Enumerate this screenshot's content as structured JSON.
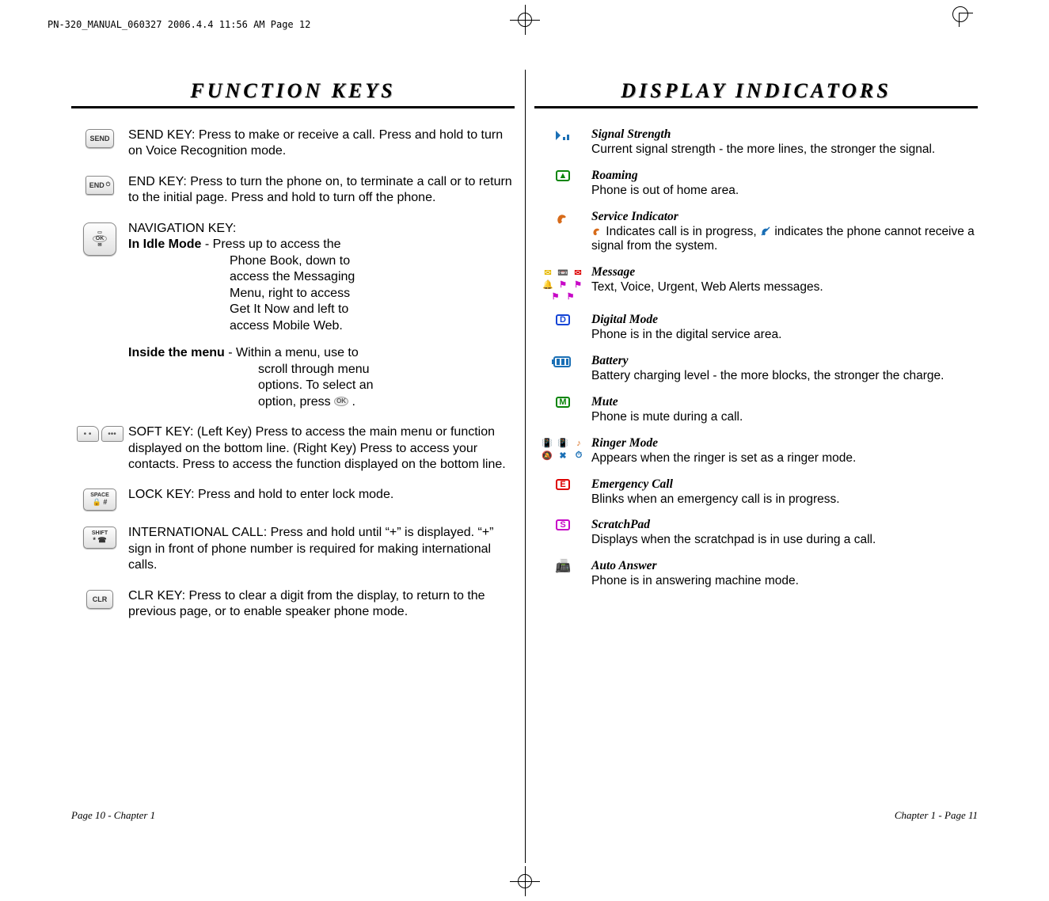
{
  "header_line": "PN-320_MANUAL_060327  2006.4.4  11:56 AM  Page 12",
  "left": {
    "title": "FUNCTION KEYS",
    "send": "SEND KEY: Press to make or receive a call. Press and hold to turn on Voice Recognition mode.",
    "end": "END KEY: Press to turn the phone on, to terminate a call or to return to the initial page. Press and hold to turn off the phone.",
    "nav_title": "NAVIGATION KEY:",
    "nav_idle_label": "In Idle Mode",
    "nav_idle_rest": " - Press up to access the",
    "nav_idle_lines": "Phone Book, down to\naccess the Messaging\nMenu, right to access\nGet It Now and left to\naccess Mobile Web.",
    "nav_menu_label": "Inside the menu",
    "nav_menu_rest": " - Within a menu, use to",
    "nav_menu_lines_a": "scroll through menu\noptions. To select an",
    "nav_menu_lines_b": "option, press ",
    "nav_menu_lines_c": " .",
    "soft": "SOFT KEY: (Left Key) Press to access the main menu or function displayed on the bottom line. (Right Key) Press to access your contacts. Press to access the function displayed on the bottom line.",
    "lock": "LOCK KEY: Press and hold to enter lock mode.",
    "intl": "INTERNATIONAL CALL: Press and hold until “+” is displayed. “+” sign in front of phone number is required for making international calls.",
    "clr": "CLR KEY: Press to clear a digit from the display, to return to the previous page, or to enable speaker phone mode.",
    "footer": "Page 10 - Chapter 1",
    "key_labels": {
      "send": "SEND",
      "end": "END",
      "ok": "OK",
      "space": "SPACE",
      "lock": "🔒 #",
      "shift": "SHIFT",
      "star": "* ☎",
      "clr": "CLR",
      "soft_left": "• •",
      "soft_right": "•••"
    }
  },
  "right": {
    "title": "DISPLAY INDICATORS",
    "items": [
      {
        "icon": "signal",
        "title": "Signal Strength",
        "desc": "Current signal strength - the more lines, the stronger the signal."
      },
      {
        "icon": "roaming",
        "title": "Roaming",
        "desc": "Phone is out of home area."
      },
      {
        "icon": "service",
        "title": "Service Indicator",
        "desc_a": " Indicates call is in progress, ",
        "desc_b": " indicates the phone cannot receive a signal from the system."
      },
      {
        "icon": "message",
        "title": "Message",
        "desc": "Text, Voice, Urgent, Web Alerts messages."
      },
      {
        "icon": "digital",
        "title": "Digital Mode",
        "desc": "Phone is in the digital service area."
      },
      {
        "icon": "battery",
        "title": "Battery",
        "desc": "Battery charging level - the more blocks, the stronger the charge."
      },
      {
        "icon": "mute",
        "title": "Mute",
        "desc": "Phone is mute during a call."
      },
      {
        "icon": "ringer",
        "title": "Ringer Mode",
        "desc": "Appears when the ringer is set as a ringer mode."
      },
      {
        "icon": "emergency",
        "title": "Emergency Call",
        "desc": "Blinks when an emergency call is in progress."
      },
      {
        "icon": "scratch",
        "title": "ScratchPad",
        "desc": "Displays when the scratchpad is in use during a call."
      },
      {
        "icon": "auto",
        "title": "Auto Answer",
        "desc": "Phone is in answering machine mode."
      }
    ],
    "footer": "Chapter 1 - Page 11"
  }
}
